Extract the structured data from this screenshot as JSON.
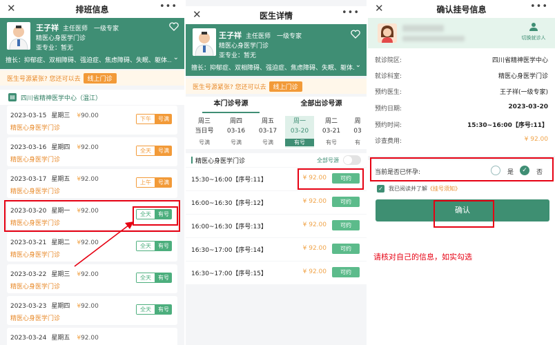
{
  "panel1": {
    "title": "排班信息",
    "close_icon": "close-icon",
    "more_icon": "more-icon",
    "doctor": {
      "name": "王子祥",
      "title": "主任医师　一级专家",
      "dept": "精医心身医学门诊",
      "subspecialty": "亚专业：暂无",
      "specialty": "擅长：抑郁症、双相障碍、强迫症、焦虑障碍、失眠、躯体..."
    },
    "notice": "医生号源紧张? 您还可以去",
    "notice_button": "线上门诊",
    "hospital": "四川省精神医学中心（温江）",
    "dates": [
      {
        "date": "2023-03-15",
        "weekday": "星期三",
        "price": "90.00",
        "dept": "精医心身医学门诊",
        "period": "下午",
        "status": "号满"
      },
      {
        "date": "2023-03-16",
        "weekday": "星期四",
        "price": "92.00",
        "dept": "精医心身医学门诊",
        "period": "全天",
        "status": "号满"
      },
      {
        "date": "2023-03-17",
        "weekday": "星期五",
        "price": "92.00",
        "dept": "精医心身医学门诊",
        "period": "上午",
        "status": "号满"
      },
      {
        "date": "2023-03-20",
        "weekday": "星期一",
        "price": "92.00",
        "dept": "精医心身医学门诊",
        "period": "全天",
        "status": "有号"
      },
      {
        "date": "2023-03-21",
        "weekday": "星期二",
        "price": "92.00",
        "dept": "精医心身医学门诊",
        "period": "全天",
        "status": "有号"
      },
      {
        "date": "2023-03-22",
        "weekday": "星期三",
        "price": "92.00",
        "dept": "精医心身医学门诊",
        "period": "全天",
        "status": "有号"
      },
      {
        "date": "2023-03-23",
        "weekday": "星期四",
        "price": "92.00",
        "dept": "精医心身医学门诊",
        "period": "全天",
        "status": "有号"
      },
      {
        "date": "2023-03-24",
        "weekday": "星期五",
        "price": "92.00",
        "dept": "",
        "period": "",
        "status": ""
      }
    ],
    "yen": "¥"
  },
  "panel2": {
    "title": "医生详情",
    "doctor": {
      "name": "王子祥",
      "title": "主任医师　一级专家",
      "dept": "精医心身医学门诊",
      "subspecialty": "亚专业：暂无",
      "specialty": "擅长：抑郁症、双相障碍、强迫症、焦虑障碍、失眠、躯体..."
    },
    "notice": "医生号源紧张? 您还可以去",
    "notice_button": "线上门诊",
    "tabs": [
      "本门诊号源",
      "全部出诊号源"
    ],
    "day_columns": [
      {
        "l1": "周三",
        "l2": "当日号",
        "status": "号满"
      },
      {
        "l1": "周四",
        "l2": "03-16",
        "status": "号满"
      },
      {
        "l1": "周五",
        "l2": "03-17",
        "status": "号满"
      },
      {
        "l1": "周一",
        "l2": "03-20",
        "status": "有号"
      },
      {
        "l1": "周二",
        "l2": "03-21",
        "status": "有号"
      },
      {
        "l1": "周",
        "l2": "03",
        "status": "有"
      }
    ],
    "section_label": "精医心身医学门诊",
    "all_sources": "全部号源",
    "slots": [
      {
        "time": "15:30~16:00【序号:11】",
        "price": "¥ 92.00",
        "action": "可约"
      },
      {
        "time": "16:00~16:30【序号:12】",
        "price": "¥ 92.00",
        "action": "可约"
      },
      {
        "time": "16:00~16:30【序号:13】",
        "price": "¥ 92.00",
        "action": "可约"
      },
      {
        "time": "16:30~17:00【序号:14】",
        "price": "¥ 92.00",
        "action": "可约"
      },
      {
        "time": "16:30~17:00【序号:15】",
        "price": "¥ 92.00",
        "action": "可约"
      }
    ]
  },
  "panel3": {
    "title": "确认挂号信息",
    "switch_label": "切换就诊人",
    "rows": [
      {
        "label": "就诊院区:",
        "value": "四川省精神医学中心"
      },
      {
        "label": "就诊科室:",
        "value": "精医心身医学门诊"
      },
      {
        "label": "预约医生:",
        "value": "王子祥(一级专家)"
      },
      {
        "label": "预约日期:",
        "value": "2023-03-20"
      },
      {
        "label": "预约时间:",
        "value": "15:30~16:00【序号:11】"
      },
      {
        "label": "诊查费用:",
        "value": "¥ 92.00"
      }
    ],
    "pregnancy_question": "当前是否已怀孕:",
    "option_yes": "是",
    "option_no": "否",
    "agree_text": "我已阅读并了解",
    "agree_link": "《挂号须知》",
    "confirm_button": "确认",
    "annotation": "请核对自己的信息，如实勾选"
  },
  "colors": {
    "brand_green": "#3f8e74",
    "annotation_red": "#e60012",
    "price_orange": "#f0a44a"
  }
}
